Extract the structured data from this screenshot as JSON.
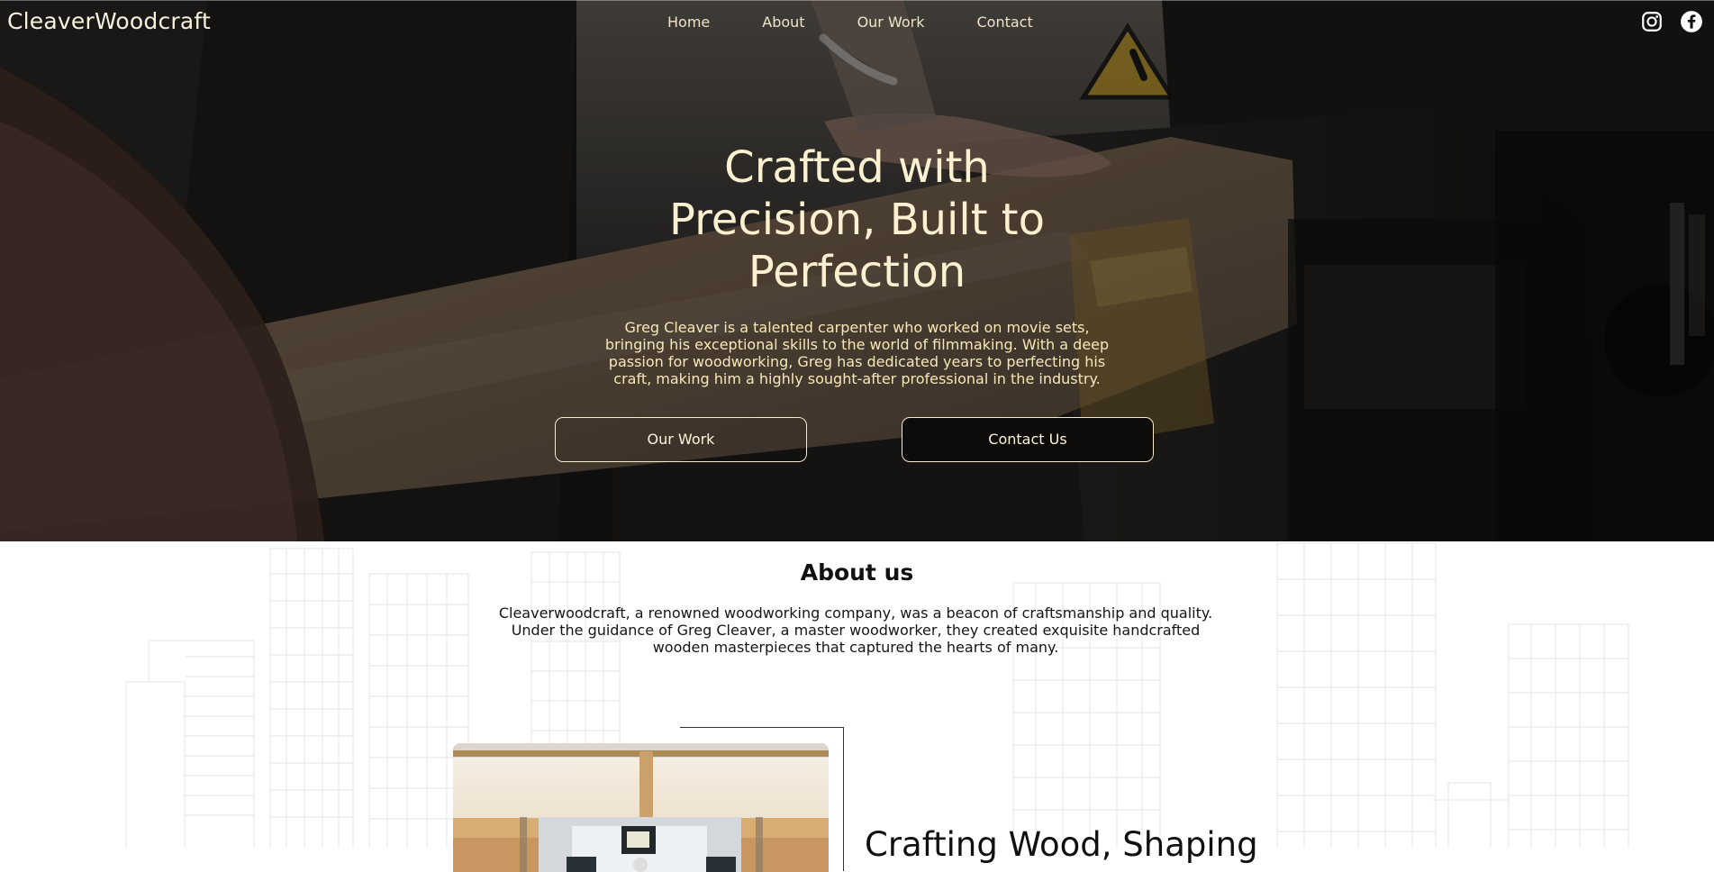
{
  "site": {
    "brand": "CleaverWoodcraft"
  },
  "nav": {
    "items": [
      "Home",
      "About",
      "Our Work",
      "Contact"
    ]
  },
  "social": {
    "items": [
      "instagram-icon",
      "facebook-icon"
    ]
  },
  "hero": {
    "title_line_1": "Crafted with",
    "title_line_2": "Precision, Built to",
    "title_line_3": "Perfection",
    "text": "Greg Cleaver is a talented carpenter who worked on movie sets, bringing his exceptional skills to the world of filmmaking. With a deep passion for woodworking, Greg has dedicated years to perfecting his craft, making him a highly sought-after professional in the industry.",
    "buttons": [
      "Our Work",
      "Contact Us"
    ]
  },
  "about": {
    "heading": "About us",
    "text": "Cleaverwoodcraft, a renowned woodworking company, was a beacon of craftsmanship and quality. Under the guidance of Greg Cleaver, a master woodworker, they created exquisite handcrafted wooden masterpieces that captured the hearts of many.",
    "subheading": "Crafting Wood, Shaping"
  }
}
